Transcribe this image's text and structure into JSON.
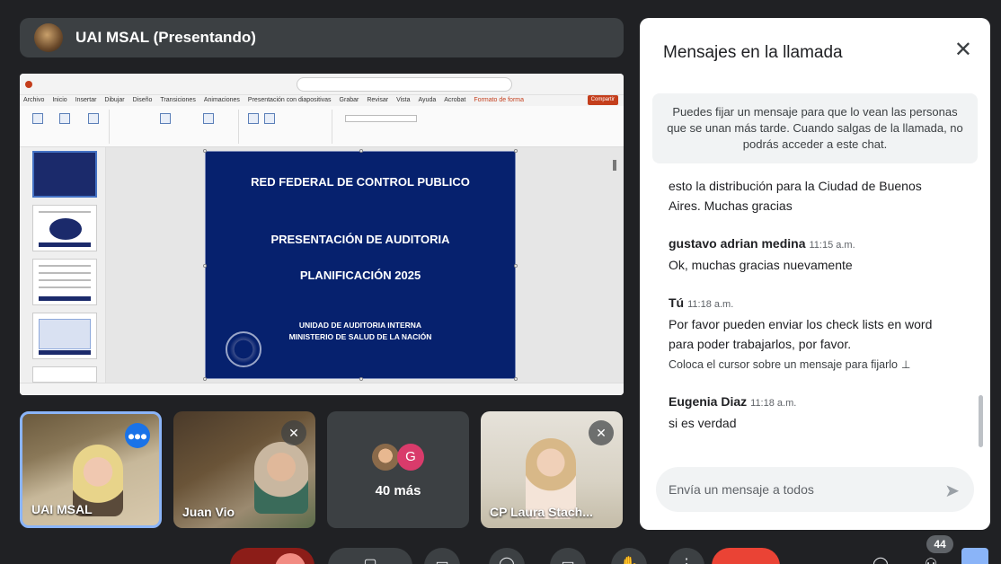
{
  "presenter": {
    "title": "UAI MSAL (Presentando)"
  },
  "slide": {
    "title": "RED FEDERAL DE CONTROL PUBLICO",
    "subtitle": "PRESENTACIÓN DE AUDITORIA",
    "plan": "PLANIFICACIÓN 2025",
    "unit_line1": "UNIDAD DE AUDITORIA INTERNA",
    "unit_line2": "MINISTERIO DE SALUD DE LA NACIÓN"
  },
  "ppt": {
    "menu": [
      "Archivo",
      "Inicio",
      "Insertar",
      "Dibujar",
      "Diseño",
      "Transiciones",
      "Animaciones",
      "Presentación con diapositivas",
      "Grabar",
      "Revisar",
      "Vista",
      "Ayuda",
      "Acrobat",
      "Formato de forma"
    ],
    "share_label": "Compartir"
  },
  "participants": {
    "tiles": [
      {
        "name": "UAI MSAL"
      },
      {
        "name": "Juan Vio"
      },
      {
        "name": "40 más",
        "avatar_letter": "G"
      },
      {
        "name": "CP Laura Stach..."
      }
    ]
  },
  "chat": {
    "title": "Mensajes en la llamada",
    "close_icon": "close-icon",
    "pin_note": "Puedes fijar un mensaje para que lo vean las personas que se unan más tarde. Cuando salgas de la llamada, no podrás acceder a este chat.",
    "messages": [
      {
        "sender": "",
        "time": "",
        "text": "esto la distribución para la Ciudad de Buenos Aires. Muchas gracias"
      },
      {
        "sender": "gustavo adrian medina",
        "time": "11:15 a.m.",
        "text": "Ok, muchas gracias nuevamente"
      },
      {
        "sender": "Tú",
        "time": "11:18 a.m.",
        "text": "Por favor pueden enviar los check lists en word para poder trabajarlos, por favor.",
        "hint": "Coloca el cursor sobre un mensaje para fijarlo"
      },
      {
        "sender": "Eugenia Diaz",
        "time": "11:18 a.m.",
        "text": "si es verdad"
      }
    ],
    "input_placeholder": "Envía un mensaje a todos"
  },
  "controls": {
    "participant_count": "44"
  },
  "colors": {
    "accent": "#8ab4f8",
    "slide_bg": "#06216e",
    "end_call": "#ea4335",
    "mic_active": "#1a73e8"
  }
}
